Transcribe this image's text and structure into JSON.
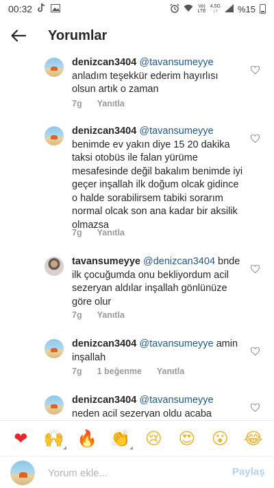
{
  "status_bar": {
    "time": "00:32",
    "network_top": "Vo)",
    "network_bottom": "LTE",
    "signal_top": "4.5G",
    "signal_bottom": "↓↑",
    "battery": "%15"
  },
  "header": {
    "title": "Yorumlar"
  },
  "comments": [
    {
      "user": "denizcan3404",
      "mention": "@tavansumeyye",
      "text": "anladım teşekkür ederim hayırlısı olsun artık o zaman",
      "time": "7g",
      "likes": "",
      "reply_label": "Yanıtla",
      "avatar": "beach"
    },
    {
      "user": "denizcan3404",
      "mention": "@tavansumeyye",
      "text": "benimde ev yakın diye 15 20 dakika taksi otobüs ile falan yürüme mesafesinde değil bakalım benimde iyi geçer inşallah ilk doğum olcak gidince o halde sorabilirsem tabiki sorarım normal olcak son ana kadar bir aksilik olmazsa",
      "time": "7g",
      "likes": "",
      "reply_label": "Yanıtla",
      "avatar": "beach"
    },
    {
      "user": "tavansumeyye",
      "mention": "@denizcan3404",
      "text": "bnde ilk çocuğumda onu bekliyordum acil sezeryan aldılar inşallah gönlünüze göre olur",
      "time": "7g",
      "likes": "",
      "reply_label": "Yanıtla",
      "avatar": "person"
    },
    {
      "user": "denizcan3404",
      "mention": "@tavansumeyye",
      "text": "amin inşallah",
      "time": "7g",
      "likes": "1 beğenme",
      "reply_label": "Yanıtla",
      "avatar": "beach"
    },
    {
      "user": "denizcan3404",
      "mention": "@tavansumeyye",
      "text": "neden acil sezeryan oldu acaba",
      "time": "",
      "likes": "",
      "reply_label": "",
      "avatar": "beach"
    }
  ],
  "emoji_bar": [
    {
      "glyph": "❤",
      "name": "red-heart-emoji",
      "color": "#e8262d"
    },
    {
      "glyph": "🙌",
      "name": "raising-hands-emoji",
      "color": "#f0b429"
    },
    {
      "glyph": "🔥",
      "name": "fire-emoji",
      "color": "#f26a1b"
    },
    {
      "glyph": "👏",
      "name": "clapping-hands-emoji",
      "color": "#f0b429"
    },
    {
      "glyph": "😢",
      "name": "crying-face-emoji",
      "color": "#f0b429"
    },
    {
      "glyph": "😍",
      "name": "heart-eyes-emoji",
      "color": "#f0b429"
    },
    {
      "glyph": "😮",
      "name": "surprised-face-emoji",
      "color": "#f0b429"
    },
    {
      "glyph": "😂",
      "name": "tears-of-joy-emoji",
      "color": "#f0b429"
    }
  ],
  "composer": {
    "placeholder": "Yorum ekle...",
    "post_label": "Paylaş"
  },
  "colors": {
    "mention": "#1d5a8f",
    "meta_gray": "#999999",
    "post_button_disabled": "#b3d4f5"
  }
}
